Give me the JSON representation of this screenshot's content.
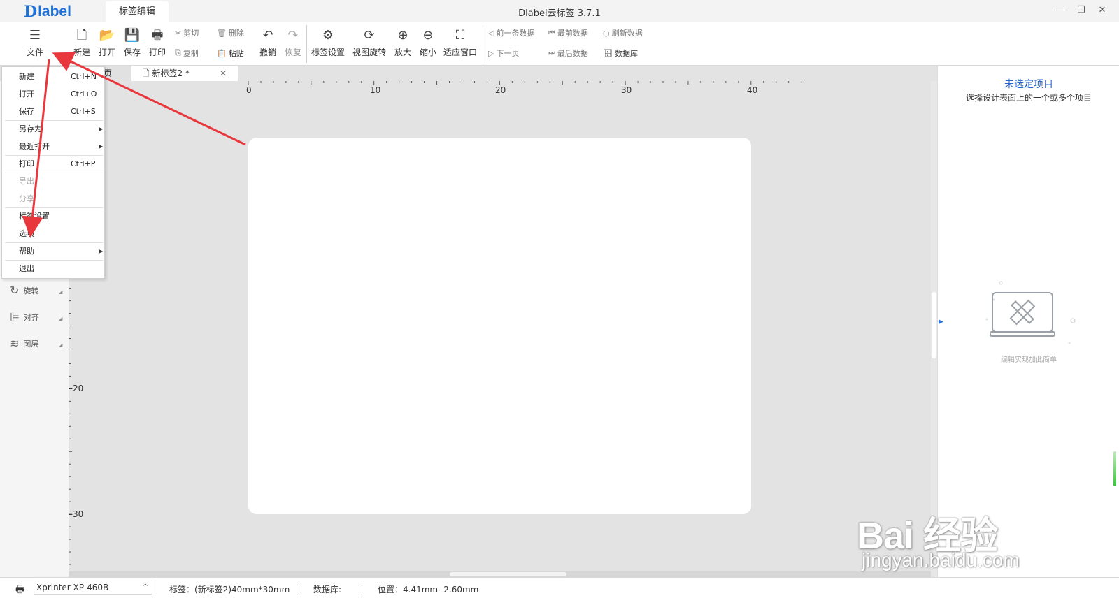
{
  "app": {
    "logo_mark": "D",
    "logo_word": "label",
    "tab_label": "标签编辑",
    "window_title": "Dlabel云标签 3.7.1"
  },
  "window_controls": {
    "minimize": "—",
    "restore": "❐",
    "close": "✕"
  },
  "toolbar": {
    "file": "文件",
    "new": "新建",
    "open": "打开",
    "save": "保存",
    "print": "打印",
    "cut": "剪切",
    "copy": "复制",
    "delete": "删除",
    "paste": "粘贴",
    "undo": "撤销",
    "redo": "恢复",
    "label_settings": "标签设置",
    "view_rotate": "视图旋转",
    "zoom_in": "放大",
    "zoom_out": "缩小",
    "fit_window": "适应窗口",
    "prev_record": "前一条数据",
    "next_page": "下一页",
    "first_record": "最前数据",
    "last_record": "最后数据",
    "refresh_data": "刷新数据",
    "database": "数据库"
  },
  "doc_tabs": {
    "home_partial": "页",
    "active": "新标签2 *",
    "close": "✕"
  },
  "file_menu": {
    "items": [
      {
        "label": "新建",
        "shortcut": "Ctrl+N"
      },
      {
        "label": "打开",
        "shortcut": "Ctrl+O"
      },
      {
        "label": "保存",
        "shortcut": "Ctrl+S"
      },
      {
        "label": "另存为",
        "submenu": "▶"
      },
      {
        "label": "最近打开",
        "submenu": "▶"
      },
      {
        "label": "打印",
        "shortcut": "Ctrl+P"
      },
      {
        "label": "导出"
      },
      {
        "label": "分享"
      },
      {
        "label": "标签设置"
      },
      {
        "label": "选项"
      },
      {
        "label": "帮助",
        "submenu": "▶"
      },
      {
        "label": "退出"
      }
    ]
  },
  "left_tools": {
    "rotate": "旋转",
    "align": "对齐",
    "layer": "图层"
  },
  "ruler": {
    "top_ticks": [
      "0",
      "10",
      "20",
      "30",
      "40"
    ],
    "left_ticks": [
      "20",
      "30"
    ]
  },
  "right_panel": {
    "title": "未选定项目",
    "subtitle": "选择设计表面上的一个或多个项目",
    "hint": "编辑实现加此简单"
  },
  "status": {
    "printer": "Xprinter XP-460B",
    "label_info": "标签：(新标签2)40mm*30mm",
    "database": "数据库:",
    "position": "位置：4.41mm -2.60mm"
  },
  "watermark": {
    "logo": "Bai 经验",
    "url": "jingyan.baidu.com"
  },
  "colors": {
    "accent": "#2a63c9",
    "annotation_arrow": "#e8383d",
    "canvas_bg": "#e3e3e3",
    "label_paper": "#ffffff"
  }
}
